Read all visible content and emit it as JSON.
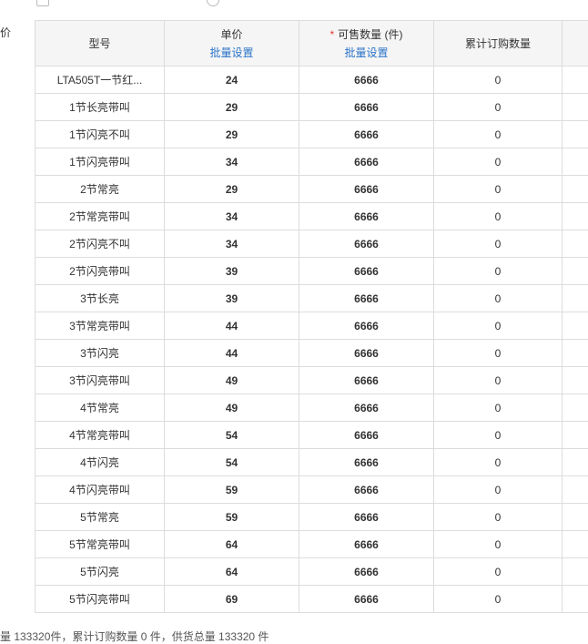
{
  "left_label": "价",
  "table": {
    "headers": {
      "model": "型号",
      "price": "单价",
      "price_batch": "批量设置",
      "required_mark": "*",
      "qty": "可售数量 (件)",
      "qty_batch": "批量设置",
      "ordered": "累计订购数量"
    },
    "rows": [
      {
        "model": "LTA505T一节红...",
        "price": "24",
        "qty": "6666",
        "ordered": "0"
      },
      {
        "model": "1节长亮带叫",
        "price": "29",
        "qty": "6666",
        "ordered": "0"
      },
      {
        "model": "1节闪亮不叫",
        "price": "29",
        "qty": "6666",
        "ordered": "0"
      },
      {
        "model": "1节闪亮带叫",
        "price": "34",
        "qty": "6666",
        "ordered": "0"
      },
      {
        "model": "2节常亮",
        "price": "29",
        "qty": "6666",
        "ordered": "0"
      },
      {
        "model": "2节常亮带叫",
        "price": "34",
        "qty": "6666",
        "ordered": "0"
      },
      {
        "model": "2节闪亮不叫",
        "price": "34",
        "qty": "6666",
        "ordered": "0"
      },
      {
        "model": "2节闪亮带叫",
        "price": "39",
        "qty": "6666",
        "ordered": "0"
      },
      {
        "model": "3节长亮",
        "price": "39",
        "qty": "6666",
        "ordered": "0"
      },
      {
        "model": "3节常亮带叫",
        "price": "44",
        "qty": "6666",
        "ordered": "0"
      },
      {
        "model": "3节闪亮",
        "price": "44",
        "qty": "6666",
        "ordered": "0"
      },
      {
        "model": "3节闪亮带叫",
        "price": "49",
        "qty": "6666",
        "ordered": "0"
      },
      {
        "model": "4节常亮",
        "price": "49",
        "qty": "6666",
        "ordered": "0"
      },
      {
        "model": "4节常亮带叫",
        "price": "54",
        "qty": "6666",
        "ordered": "0"
      },
      {
        "model": "4节闪亮",
        "price": "54",
        "qty": "6666",
        "ordered": "0"
      },
      {
        "model": "4节闪亮带叫",
        "price": "59",
        "qty": "6666",
        "ordered": "0"
      },
      {
        "model": "5节常亮",
        "price": "59",
        "qty": "6666",
        "ordered": "0"
      },
      {
        "model": "5节常亮带叫",
        "price": "64",
        "qty": "6666",
        "ordered": "0"
      },
      {
        "model": "5节闪亮",
        "price": "64",
        "qty": "6666",
        "ordered": "0"
      },
      {
        "model": "5节闪亮带叫",
        "price": "69",
        "qty": "6666",
        "ordered": "0"
      }
    ]
  },
  "footer": {
    "summary": "量 133320件，累计订购数量 0 件，供货总量 133320 件"
  },
  "colors": {
    "link": "#2a73c9",
    "required": "#e4393c",
    "header_bg": "#f5f5f5",
    "border": "#dcdcdc"
  }
}
